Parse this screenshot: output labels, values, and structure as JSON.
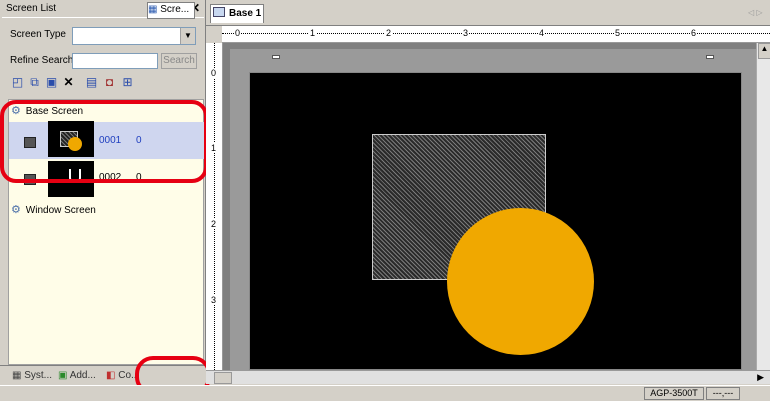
{
  "panel": {
    "title": "Screen List",
    "pin": "ꟼ",
    "close": "✕"
  },
  "filter": {
    "screen_type_label": "Screen Type",
    "screen_type_value": "",
    "refine_label": "Refine Search",
    "refine_value": "",
    "search_button": "Search"
  },
  "tree": {
    "base_group": "Base Screen",
    "window_group": "Window Screen",
    "items": [
      {
        "number": "0001",
        "extra": "0"
      },
      {
        "number": "0002",
        "extra": "0"
      }
    ]
  },
  "tabs": [
    "Syst...",
    "Add...",
    "Co...",
    "Scre..."
  ],
  "document": {
    "tab_title": "Base 1"
  },
  "ruler": {
    "h": [
      "0",
      "1",
      "2",
      "3",
      "4",
      "5",
      "6"
    ],
    "v": [
      "0",
      "1",
      "2",
      "3"
    ]
  },
  "status": {
    "model": "AGP-3500T",
    "coords": "---,---"
  },
  "colors": {
    "highlight": "#e60012",
    "circle": "#f0a800",
    "selection": "#cfd6ef"
  }
}
